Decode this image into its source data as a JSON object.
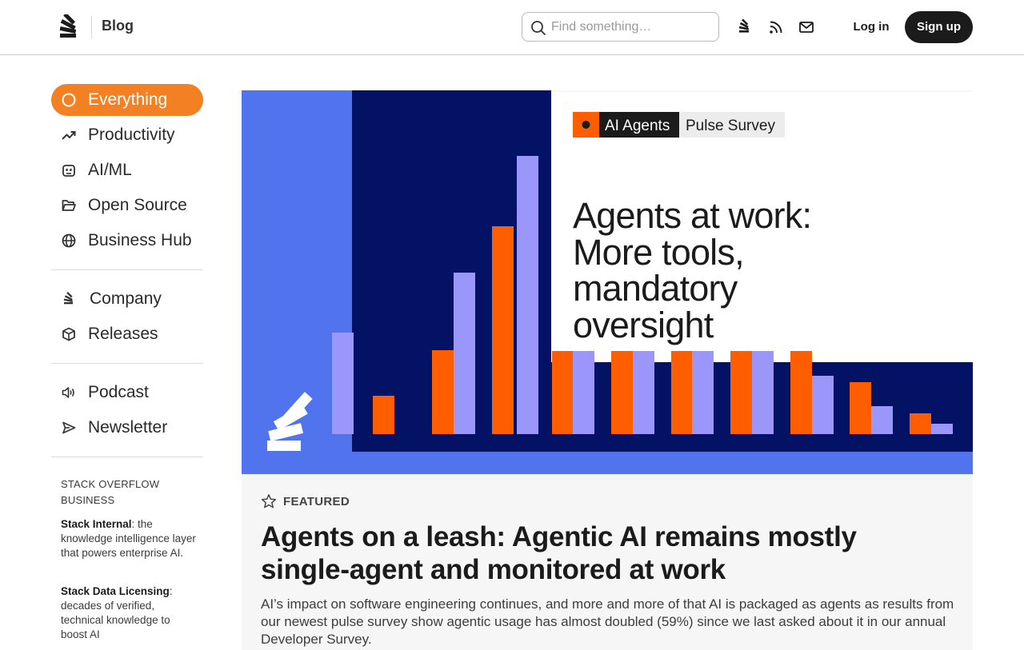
{
  "header": {
    "blog_label": "Blog",
    "search_placeholder": "Find something…",
    "login_label": "Log in",
    "signup_label": "Sign up",
    "icons": [
      "stackoverflow-icon",
      "rss-icon",
      "mail-icon"
    ]
  },
  "sidebar": {
    "primary": [
      {
        "label": "Everything",
        "icon": "circle-icon",
        "active": true
      },
      {
        "label": "Productivity",
        "icon": "trending-up-icon"
      },
      {
        "label": "AI/ML",
        "icon": "robot-icon"
      },
      {
        "label": "Open Source",
        "icon": "folder-open-icon"
      },
      {
        "label": "Business Hub",
        "icon": "globe-icon"
      }
    ],
    "secondary": [
      {
        "label": "Company",
        "icon": "stackoverflow-icon"
      },
      {
        "label": "Releases",
        "icon": "cube-icon"
      }
    ],
    "tertiary": [
      {
        "label": "Podcast",
        "icon": "speaker-icon"
      },
      {
        "label": "Newsletter",
        "icon": "send-icon"
      }
    ],
    "business": {
      "heading": "STACK OVERFLOW BUSINESS",
      "items": [
        {
          "name": "Stack Internal",
          "desc": ": the knowledge intelligence layer that powers enterprise AI."
        },
        {
          "name": "Stack Data Licensing",
          "desc": ": decades of verified, technical knowledge to boost AI"
        }
      ]
    }
  },
  "hero": {
    "tag_primary": "AI Agents",
    "tag_secondary": "Pulse Survey",
    "headline": [
      "Agents at work:",
      "More tools,",
      "mandatory",
      "oversight"
    ],
    "colors": {
      "blue": "#5174ee",
      "navy": "#031265",
      "orange": "#ff5e00",
      "lavender": "#9b96fa"
    }
  },
  "post": {
    "featured_label": "FEATURED",
    "title": "Agents on a leash: Agentic AI remains mostly single-agent and monitored at work",
    "excerpt": "AI’s impact on software engineering continues, and more and more of that AI is packaged as agents as results from our newest pulse survey show agentic usage has almost doubled (59%) since we last asked about it in our annual Developer Survey."
  }
}
